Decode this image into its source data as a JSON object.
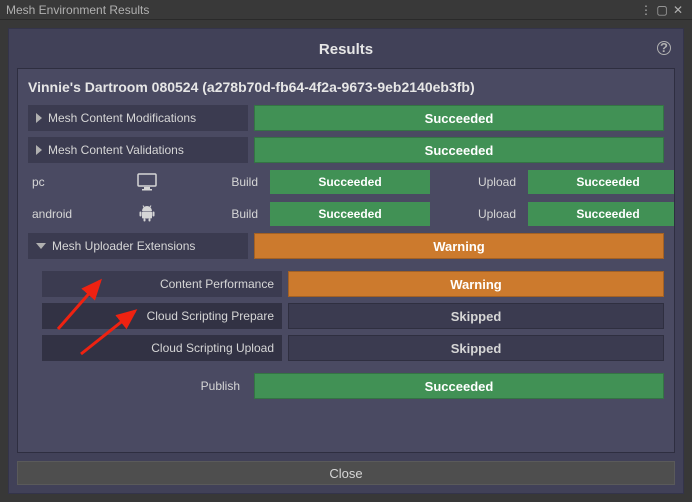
{
  "window": {
    "title": "Mesh Environment Results"
  },
  "heading": "Results",
  "project_title": "Vinnie's Dartroom 080524 (a278b70d-fb64-4f2a-9673-9eb2140eb3fb)",
  "top_sections": [
    {
      "label": "Mesh Content Modifications",
      "status_text": "Succeeded",
      "status": "success"
    },
    {
      "label": "Mesh Content Validations",
      "status_text": "Succeeded",
      "status": "success"
    }
  ],
  "platforms": [
    {
      "name": "pc",
      "icon": "monitor",
      "build_label": "Build",
      "build_status_text": "Succeeded",
      "upload_label": "Upload",
      "upload_status_text": "Succeeded"
    },
    {
      "name": "android",
      "icon": "android",
      "build_label": "Build",
      "build_status_text": "Succeeded",
      "upload_label": "Upload",
      "upload_status_text": "Succeeded"
    }
  ],
  "uploader_section": {
    "label": "Mesh Uploader Extensions",
    "status_text": "Warning",
    "children": [
      {
        "label": "Content Performance",
        "status_text": "Warning",
        "status": "warning"
      },
      {
        "label": "Cloud Scripting Prepare",
        "status_text": "Skipped",
        "status": "skipped"
      },
      {
        "label": "Cloud Scripting Upload",
        "status_text": "Skipped",
        "status": "skipped"
      }
    ]
  },
  "publish": {
    "label": "Publish",
    "status_text": "Succeeded"
  },
  "close_label": "Close"
}
